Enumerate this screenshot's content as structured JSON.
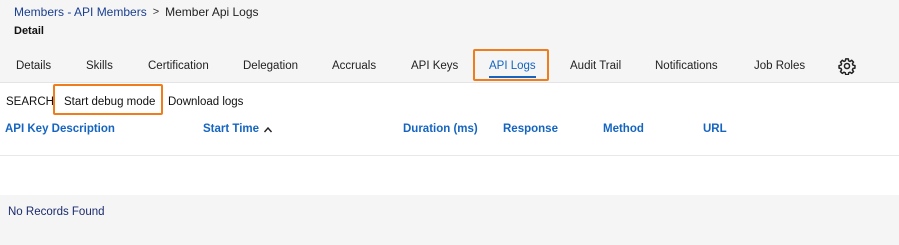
{
  "breadcrumb": {
    "parent": "Members - API Members",
    "separator": ">",
    "current": "Member Api Logs"
  },
  "page_title": "Detail",
  "tabs": [
    {
      "label": "Details",
      "active": false
    },
    {
      "label": "Skills",
      "active": false
    },
    {
      "label": "Certification",
      "active": false
    },
    {
      "label": "Delegation",
      "active": false
    },
    {
      "label": "Accruals",
      "active": false
    },
    {
      "label": "API Keys",
      "active": false
    },
    {
      "label": "API Logs",
      "active": true
    },
    {
      "label": "Audit Trail",
      "active": false
    },
    {
      "label": "Notifications",
      "active": false
    },
    {
      "label": "Job Roles",
      "active": false
    }
  ],
  "settings_icon": "gear-icon",
  "toolbar": {
    "search_label": "SEARCH",
    "debug_label": "Start debug mode",
    "download_label": "Download logs"
  },
  "table": {
    "columns": [
      {
        "label": "API Key Description"
      },
      {
        "label": "Start Time",
        "sort": "ascending"
      },
      {
        "label": "Duration (ms)"
      },
      {
        "label": "Response"
      },
      {
        "label": "Method"
      },
      {
        "label": "URL"
      }
    ],
    "empty_message": "No Records Found"
  },
  "colors": {
    "accent": "#1565c0",
    "highlight": "#f07d1c",
    "link": "#1a3f8f"
  }
}
